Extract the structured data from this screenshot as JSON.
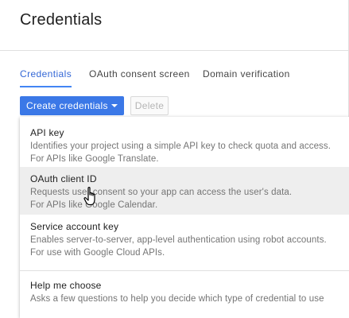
{
  "page": {
    "title": "Credentials"
  },
  "tabs": [
    {
      "label": "Credentials",
      "active": true
    },
    {
      "label": "OAuth consent screen",
      "active": false
    },
    {
      "label": "Domain verification",
      "active": false
    }
  ],
  "toolbar": {
    "create_label": "Create credentials",
    "delete_label": "Delete"
  },
  "menu": {
    "items": [
      {
        "title": "API key",
        "desc1": "Identifies your project using a simple API key to check quota and access.",
        "desc2": "For APIs like Google Translate."
      },
      {
        "title": "OAuth client ID",
        "desc1": "Requests user consent so your app can access the user's data.",
        "desc2": "For APIs like Google Calendar."
      },
      {
        "title": "Service account key",
        "desc1": "Enables server-to-server, app-level authentication using robot accounts.",
        "desc2": "For use with Google Cloud APIs."
      },
      {
        "title": "Help me choose",
        "desc1": "Asks a few questions to help you decide which type of credential to use"
      }
    ],
    "hovered_index": 1
  },
  "icons": {
    "cursor": "hand-pointer-icon",
    "caret": "caret-down-icon"
  },
  "colors": {
    "primary": "#3b78e7",
    "active_tab": "#3367d6",
    "hover_bg": "#eeeeee"
  }
}
